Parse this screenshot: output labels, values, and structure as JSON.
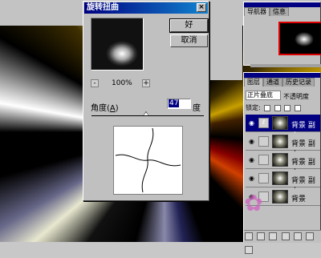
{
  "dialog": {
    "title": "旋转扭曲",
    "close_glyph": "×",
    "ok_label": "好",
    "cancel_label": "取消",
    "zoom_level": "100%",
    "zoom_minus": "-",
    "zoom_plus": "+",
    "angle_label": "角度",
    "angle_hotkey": "A",
    "angle_value": "47",
    "angle_unit": "度"
  },
  "navigator": {
    "tabs": [
      "导航器",
      "信息"
    ]
  },
  "layers": {
    "tabs": [
      "图层",
      "通道",
      "历史记录"
    ],
    "blend_mode": "正片叠底",
    "opacity_label": "不透明度",
    "lock_label": "锁定:",
    "items": [
      {
        "name": "背景 副本",
        "selected": true
      },
      {
        "name": "背景 副本",
        "selected": false
      },
      {
        "name": "背景 副本",
        "selected": false
      },
      {
        "name": "背景 副本",
        "selected": false
      },
      {
        "name": "背景",
        "selected": false
      }
    ]
  },
  "icons": {
    "eye": "eye-icon",
    "brush": "brush-icon",
    "lock": "lock-icon"
  },
  "colors": {
    "titlebar": "#000080",
    "dialog_bg": "#c0c0c0",
    "highlight": "#000080"
  }
}
